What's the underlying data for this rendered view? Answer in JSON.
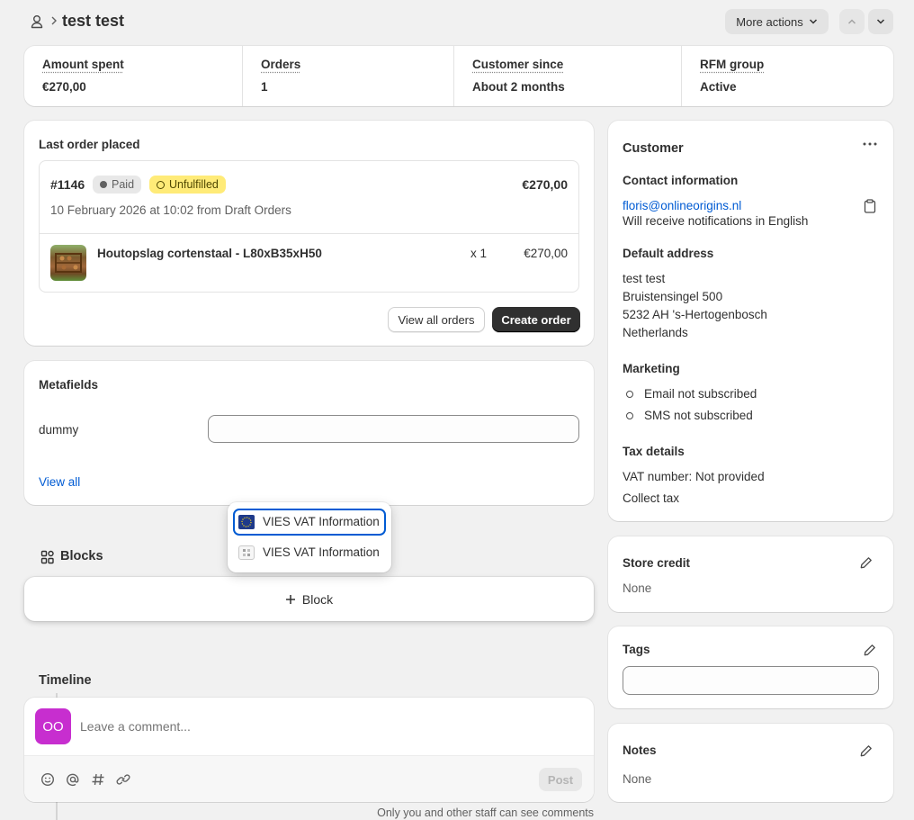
{
  "header": {
    "title": "test test",
    "more_actions": "More actions"
  },
  "stats": [
    {
      "label": "Amount spent",
      "value": "€270,00"
    },
    {
      "label": "Orders",
      "value": "1"
    },
    {
      "label": "Customer since",
      "value": "About 2 months"
    },
    {
      "label": "RFM group",
      "value": "Active"
    }
  ],
  "last_order": {
    "heading": "Last order placed",
    "number": "#1146",
    "payment_status": "Paid",
    "fulfillment_status": "Unfulfilled",
    "total": "€270,00",
    "meta": "10 February 2026 at 10:02 from Draft Orders",
    "item_name": "Houtopslag cortenstaal - L80xB35xH50",
    "item_qty": "x 1",
    "item_price": "€270,00",
    "view_all": "View all orders",
    "create": "Create order"
  },
  "metafields": {
    "heading": "Metafields",
    "field_label": "dummy",
    "field_value": "",
    "view_all": "View all"
  },
  "popover": {
    "items": [
      "VIES VAT Information",
      "VIES VAT Information"
    ]
  },
  "blocks": {
    "heading": "Blocks",
    "add_label": "Block"
  },
  "timeline": {
    "heading": "Timeline",
    "avatar_initials": "OO",
    "placeholder": "Leave a comment...",
    "post": "Post",
    "note": "Only you and other staff can see comments"
  },
  "customer": {
    "heading": "Customer",
    "contact_heading": "Contact information",
    "email": "floris@onlineorigins.nl",
    "notifications": "Will receive notifications in English",
    "address_heading": "Default address",
    "address_lines": [
      "test test",
      "Bruistensingel 500",
      "5232 AH 's-Hertogenbosch",
      "Netherlands"
    ],
    "marketing_heading": "Marketing",
    "email_marketing": "Email not subscribed",
    "sms_marketing": "SMS not subscribed",
    "tax_heading": "Tax details",
    "vat": "VAT number: Not provided",
    "collect_tax": "Collect tax"
  },
  "store_credit": {
    "heading": "Store credit",
    "value": "None"
  },
  "tags": {
    "heading": "Tags",
    "value": ""
  },
  "notes": {
    "heading": "Notes",
    "value": "None"
  },
  "colors": {
    "accent": "#005bd3",
    "unfulfilled_badge": "#ffeb78",
    "avatar": "#c72ecf",
    "primary_button": "#303030"
  }
}
